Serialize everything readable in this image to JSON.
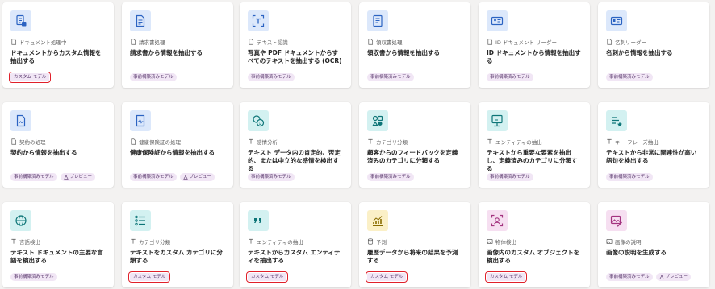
{
  "colors": {
    "tile_blue": "#dce8fb",
    "tile_teal": "#d3f1f1",
    "tile_yellow": "#fbf0c7",
    "tile_pink": "#f6dff1",
    "accent_blue": "#2b63c2",
    "accent_teal": "#0d7577",
    "accent_pink": "#a3337f",
    "highlight_red": "#e0202a"
  },
  "cards": [
    {
      "icon": "document-processing-icon",
      "category_icon": "document-icon",
      "category": "ドキュメント処理中",
      "title": "ドキュメントからカスタム情報を抽出する",
      "badges": [
        {
          "label": "カスタム モデル",
          "kind": "custom"
        }
      ]
    },
    {
      "icon": "invoice-icon",
      "category_icon": "document-icon",
      "category": "請求書処理",
      "title": "請求書から情報を抽出する",
      "badges": [
        {
          "label": "事前構築済みモデル",
          "kind": "prebuilt"
        }
      ]
    },
    {
      "icon": "text-recognition-icon",
      "category_icon": "document-icon",
      "category": "テキスト認識",
      "title": "写真や PDF ドキュメントからすべてのテキストを抽出する (OCR)",
      "badges": [
        {
          "label": "事前構築済みモデル",
          "kind": "prebuilt"
        }
      ]
    },
    {
      "icon": "receipt-icon",
      "category_icon": "document-icon",
      "category": "領収書処理",
      "title": "領収書から情報を抽出する",
      "badges": [
        {
          "label": "事前構築済みモデル",
          "kind": "prebuilt"
        }
      ]
    },
    {
      "icon": "id-card-icon",
      "category_icon": "document-icon",
      "category": "ID ドキュメント リーダー",
      "title": "ID ドキュメントから情報を抽出する",
      "badges": [
        {
          "label": "事前構築済みモデル",
          "kind": "prebuilt"
        }
      ]
    },
    {
      "icon": "business-card-icon",
      "category_icon": "document-icon",
      "category": "名刺リーダー",
      "title": "名刺から情報を抽出する",
      "badges": [
        {
          "label": "事前構築済みモデル",
          "kind": "prebuilt"
        }
      ]
    },
    {
      "icon": "contract-icon",
      "category_icon": "document-icon",
      "category": "契約の処理",
      "title": "契約から情報を抽出する",
      "badges": [
        {
          "label": "事前構築済みモデル",
          "kind": "prebuilt"
        },
        {
          "label": "プレビュー",
          "kind": "preview"
        }
      ]
    },
    {
      "icon": "health-insurance-icon",
      "category_icon": "document-icon",
      "category": "健康保険証の処理",
      "title": "健康保険証から情報を抽出する",
      "badges": [
        {
          "label": "事前構築済みモデル",
          "kind": "prebuilt"
        },
        {
          "label": "プレビュー",
          "kind": "preview"
        }
      ]
    },
    {
      "icon": "sentiment-icon",
      "category_icon": "text-icon",
      "category": "感情分析",
      "title": "テキスト データ内の肯定的、否定的、または中立的な感情を検出する",
      "badges": [
        {
          "label": "事前構築済みモデル",
          "kind": "prebuilt"
        }
      ]
    },
    {
      "icon": "category-classify-icon",
      "category_icon": "text-icon",
      "category": "カテゴリ分類",
      "title": "顧客からのフィードバックを定義済みのカテゴリに分類する",
      "badges": [
        {
          "label": "事前構築済みモデル",
          "kind": "prebuilt"
        }
      ]
    },
    {
      "icon": "entity-extraction-icon",
      "category_icon": "text-icon",
      "category": "エンティティの抽出",
      "title": "テキストから重要な要素を抽出し、定義済みのカテゴリに分類する",
      "badges": [
        {
          "label": "事前構築済みモデル",
          "kind": "prebuilt"
        }
      ]
    },
    {
      "icon": "key-phrase-icon",
      "category_icon": "text-icon",
      "category": "キー フレーズ抽出",
      "title": "テキストから非常に関連性が高い語句を検出する",
      "badges": [
        {
          "label": "事前構築済みモデル",
          "kind": "prebuilt"
        }
      ]
    },
    {
      "icon": "globe-icon",
      "category_icon": "text-icon",
      "category": "言語検出",
      "title": "テキスト ドキュメントの主要な言語を検出する",
      "badges": [
        {
          "label": "事前構築済みモデル",
          "kind": "prebuilt"
        }
      ]
    },
    {
      "icon": "list-icon",
      "category_icon": "text-icon",
      "category": "カテゴリ分類",
      "title": "テキストをカスタム カテゴリに分類する",
      "badges": [
        {
          "label": "カスタム モデル",
          "kind": "custom"
        }
      ]
    },
    {
      "icon": "quote-icon",
      "category_icon": "text-icon",
      "category": "エンティティの抽出",
      "title": "テキストからカスタム エンティティを抽出する",
      "badges": [
        {
          "label": "カスタム モデル",
          "kind": "custom"
        }
      ]
    },
    {
      "icon": "chart-trend-icon",
      "category_icon": "database-icon",
      "category": "予測",
      "title": "履歴データから将来の結果を予測する",
      "badges": [
        {
          "label": "カスタム モデル",
          "kind": "custom"
        }
      ]
    },
    {
      "icon": "object-detect-icon",
      "category_icon": "image-icon",
      "category": "物体検出",
      "title": "画像内のカスタム オブジェクトを検出する",
      "badges": [
        {
          "label": "カスタム モデル",
          "kind": "custom"
        }
      ]
    },
    {
      "icon": "image-edit-icon",
      "category_icon": "image-icon",
      "category": "画像の説明",
      "title": "画像の説明を生成する",
      "badges": [
        {
          "label": "事前構築済みモデル",
          "kind": "prebuilt"
        },
        {
          "label": "プレビュー",
          "kind": "preview"
        }
      ]
    }
  ]
}
